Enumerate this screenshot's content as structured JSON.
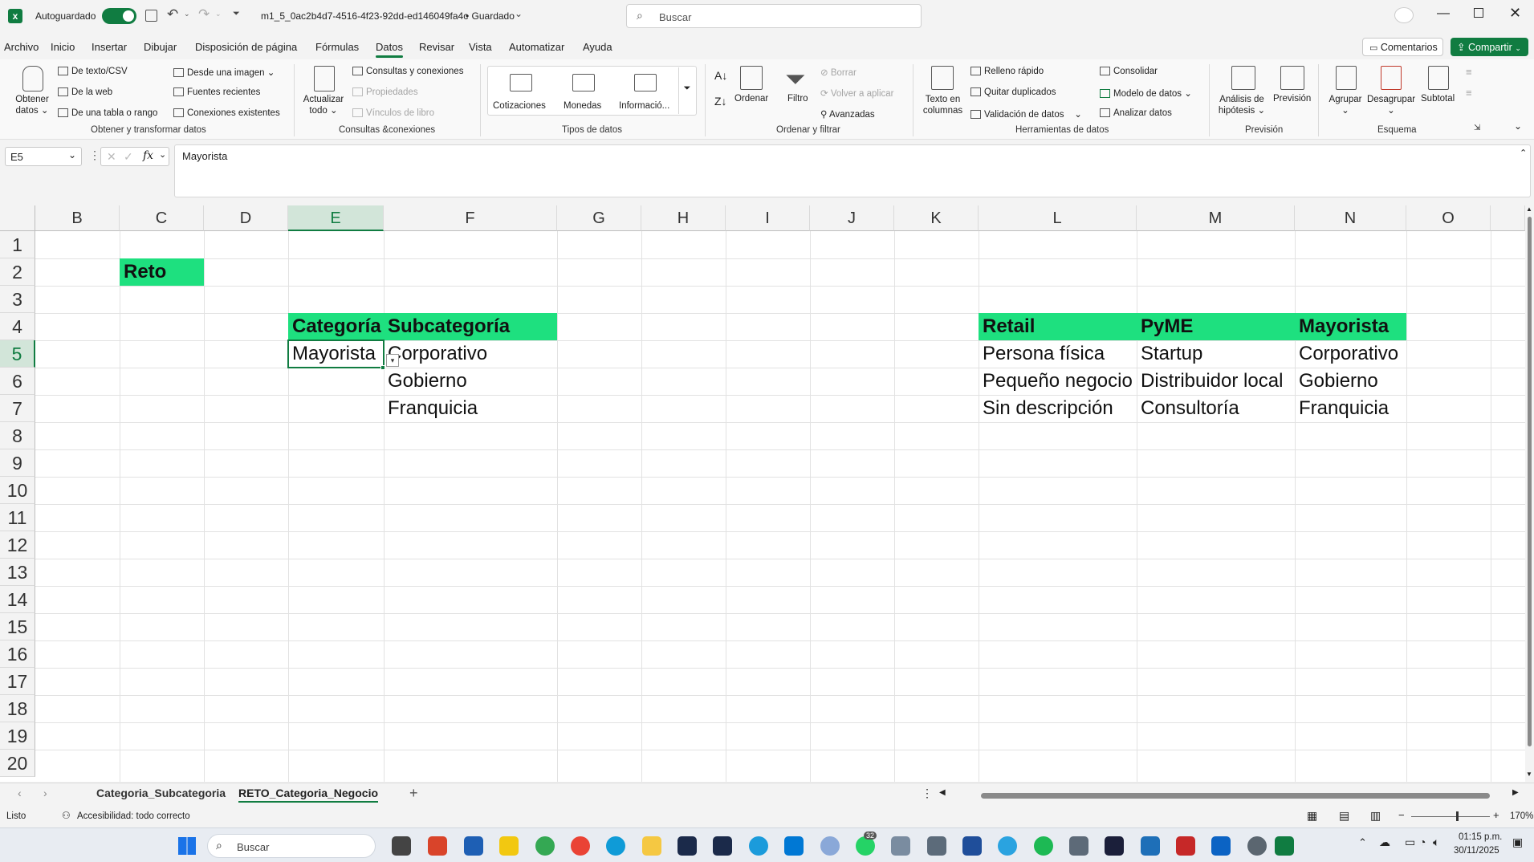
{
  "titlebar": {
    "autosave_label": "Autoguardado",
    "filename": "m1_5_0ac2b4d7-4516-4f23-92dd-ed146049fa4c",
    "save_status": "• Guardado",
    "search_placeholder": "Buscar"
  },
  "menu": {
    "items": [
      "Archivo",
      "Inicio",
      "Insertar",
      "Dibujar",
      "Disposición de página",
      "Fórmulas",
      "Datos",
      "Revisar",
      "Vista",
      "Automatizar",
      "Ayuda"
    ],
    "active": "Datos",
    "comments_label": "Comentarios",
    "share_label": "Compartir"
  },
  "ribbon": {
    "get_data": "Obtener datos",
    "from_text_csv": "De texto/CSV",
    "from_web": "De la web",
    "from_table": "De una tabla o rango",
    "from_image": "Desde una imagen",
    "recent_sources": "Fuentes recientes",
    "existing_connections": "Conexiones existentes",
    "group_get_transform": "Obtener y transformar datos",
    "refresh_all": "Actualizar todo",
    "queries_connections": "Consultas y conexiones",
    "properties": "Propiedades",
    "workbook_links": "Vínculos de libro",
    "group_queries": "Consultas &conexiones",
    "stocks": "Cotizaciones",
    "currencies": "Monedas",
    "info": "Informació...",
    "group_data_types": "Tipos de datos",
    "sort": "Ordenar",
    "filter": "Filtro",
    "clear": "Borrar",
    "reapply": "Volver a aplicar",
    "advanced": "Avanzadas",
    "group_sort_filter": "Ordenar y filtrar",
    "text_to_columns": "Texto en columnas",
    "flash_fill": "Relleno rápido",
    "remove_duplicates": "Quitar duplicados",
    "data_validation": "Validación de datos",
    "consolidate": "Consolidar",
    "data_model": "Modelo de datos",
    "analyze_data": "Analizar datos",
    "group_data_tools": "Herramientas de datos",
    "what_if": "Análisis de hipótesis",
    "forecast": "Previsión",
    "group_forecast": "Previsión",
    "group": "Agrupar",
    "ungroup": "Desagrupar",
    "subtotal": "Subtotal",
    "group_outline": "Esquema"
  },
  "formula_bar": {
    "name_box": "E5",
    "formula": "Mayorista"
  },
  "columns": [
    "B",
    "C",
    "D",
    "E",
    "F",
    "G",
    "H",
    "I",
    "J",
    "K",
    "L",
    "M",
    "N",
    "O"
  ],
  "rows": [
    "1",
    "2",
    "3",
    "4",
    "5",
    "6",
    "7",
    "8",
    "9",
    "10",
    "11",
    "12",
    "13",
    "14",
    "15",
    "16",
    "17",
    "18",
    "19",
    "20"
  ],
  "cells": {
    "c2": "Reto",
    "e4": "Categoría",
    "f4": "Subcategoría",
    "e5": "Mayorista",
    "f5": "Corporativo",
    "f6": "Gobierno",
    "f7": "Franquicia",
    "l4": "Retail",
    "m4": "PyME",
    "n4": "Mayorista",
    "l5": "Persona física",
    "m5": "Startup",
    "n5": "Corporativo",
    "l6": "Pequeño negocio",
    "m6": "Distribuidor local",
    "n6": "Gobierno",
    "l7": "Sin descripción",
    "m7": "Consultoría",
    "n7": "Franquicia"
  },
  "sheets": {
    "tabs": [
      "Categoria_Subcategoria",
      "RETO_Categoria_Negocio"
    ],
    "active": "RETO_Categoria_Negocio"
  },
  "status": {
    "ready": "Listo",
    "accessibility": "Accesibilidad: todo correcto",
    "zoom": "170%"
  },
  "taskbar": {
    "search_placeholder": "Buscar",
    "time": "01:15 p.m.",
    "date": "30/11/2025",
    "whatsapp_badge": "32"
  },
  "colors": {
    "accent": "#107c41",
    "header_fill": "#1ee07f"
  }
}
